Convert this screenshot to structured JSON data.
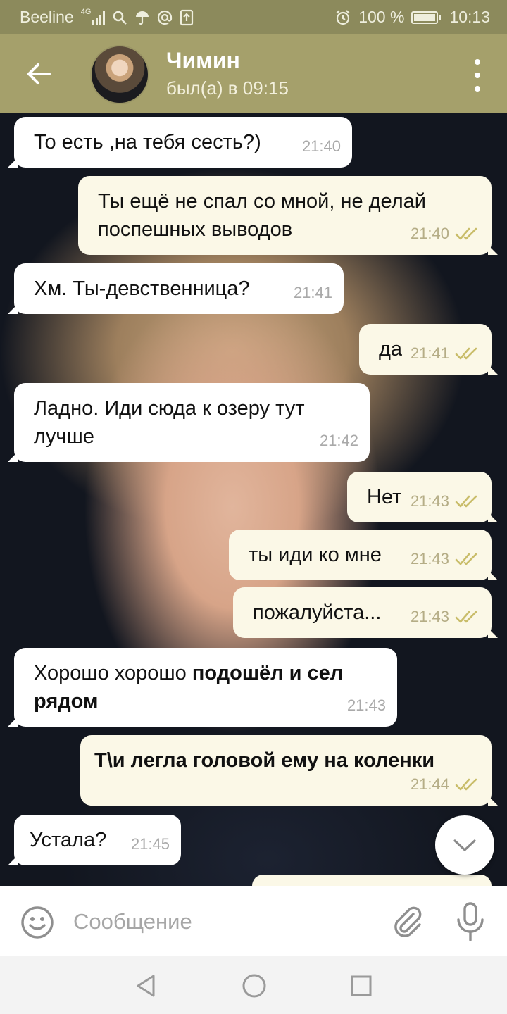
{
  "status_bar": {
    "carrier": "Beeline",
    "network": "4G",
    "battery": "100 %",
    "time": "10:13",
    "icons": [
      "signal-icon",
      "search-icon",
      "umbrella-icon",
      "at-icon",
      "upload-icon",
      "alarm-icon",
      "battery-icon"
    ]
  },
  "header": {
    "contact_name": "Чимин",
    "last_seen": "был(а) в 09:15",
    "icons": [
      "back-arrow-icon",
      "more-vertical-icon"
    ]
  },
  "messages": [
    {
      "dir": "in",
      "parts": [
        {
          "text": "То есть ,на тебя сесть?)",
          "bold": false
        }
      ],
      "time": "21:40",
      "read": false
    },
    {
      "dir": "out",
      "parts": [
        {
          "text": "Ты ещё не спал со мной, не делай поспешных выводов",
          "bold": false
        }
      ],
      "time": "21:40",
      "read": true
    },
    {
      "dir": "in",
      "parts": [
        {
          "text": "Хм. Ты-девственница?",
          "bold": false
        }
      ],
      "time": "21:41",
      "read": false
    },
    {
      "dir": "out",
      "parts": [
        {
          "text": "да",
          "bold": false
        }
      ],
      "time": "21:41",
      "read": true
    },
    {
      "dir": "in",
      "parts": [
        {
          "text": "Ладно. Иди сюда к озеру тут лучше",
          "bold": false
        }
      ],
      "time": "21:42",
      "read": false
    },
    {
      "dir": "out",
      "parts": [
        {
          "text": "Нет",
          "bold": false
        }
      ],
      "time": "21:43",
      "read": true
    },
    {
      "dir": "out",
      "parts": [
        {
          "text": "ты иди ко мне",
          "bold": false
        }
      ],
      "time": "21:43",
      "read": true
    },
    {
      "dir": "out",
      "parts": [
        {
          "text": "пожалуйста...",
          "bold": false
        }
      ],
      "time": "21:43",
      "read": true
    },
    {
      "dir": "in",
      "parts": [
        {
          "text": "Хорошо хорошо ",
          "bold": false
        },
        {
          "text": "подошёл и сел рядом",
          "bold": true
        }
      ],
      "time": "21:43",
      "read": false
    },
    {
      "dir": "out",
      "parts": [
        {
          "text": "Т\\и легла головой ему на коленки",
          "bold": true
        }
      ],
      "time": "21:44",
      "read": true
    },
    {
      "dir": "in",
      "parts": [
        {
          "text": "Устала?",
          "bold": false
        }
      ],
      "time": "21:45",
      "read": false
    }
  ],
  "scroll_down_icon": "chevron-down-icon",
  "composer": {
    "placeholder": "Сообщение",
    "value": "",
    "icons": [
      "emoji-icon",
      "paperclip-icon",
      "microphone-icon"
    ]
  },
  "navigation": {
    "icons": [
      "back-triangle-icon",
      "home-circle-icon",
      "recents-square-icon"
    ]
  },
  "colors": {
    "status_bar": "#8c8a5c",
    "header": "#a5a06b",
    "incoming_bubble": "#ffffff",
    "outgoing_bubble": "#fbf8e7",
    "read_check": "#c9bd6a"
  }
}
